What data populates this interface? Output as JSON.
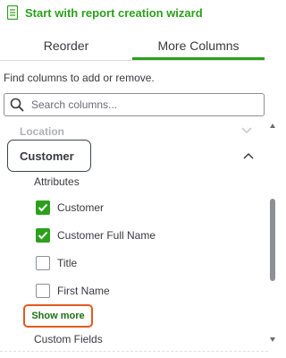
{
  "wizard": {
    "label": "Start with report creation wizard",
    "icon": "document-icon"
  },
  "tabs": [
    {
      "label": "Reorder",
      "active": false
    },
    {
      "label": "More Columns",
      "active": true
    }
  ],
  "colors": {
    "accent": "#2ca01c",
    "highlight": "#e15a1e",
    "text": "#393a3d",
    "muted": "#b0b1b5"
  },
  "hint": "Find columns to add or remove.",
  "search": {
    "placeholder": "Search columns...",
    "value": "",
    "icon": "search-icon"
  },
  "sections": {
    "location": {
      "title": "Location",
      "expanded": false
    },
    "customer": {
      "title": "Customer",
      "expanded": true,
      "group": "Attributes",
      "items": [
        {
          "label": "Customer",
          "checked": true
        },
        {
          "label": "Customer Full Name",
          "checked": true
        },
        {
          "label": "Title",
          "checked": false
        },
        {
          "label": "First Name",
          "checked": false
        }
      ],
      "show_more": "Show more"
    },
    "custom_fields": {
      "title": "Custom Fields"
    }
  }
}
